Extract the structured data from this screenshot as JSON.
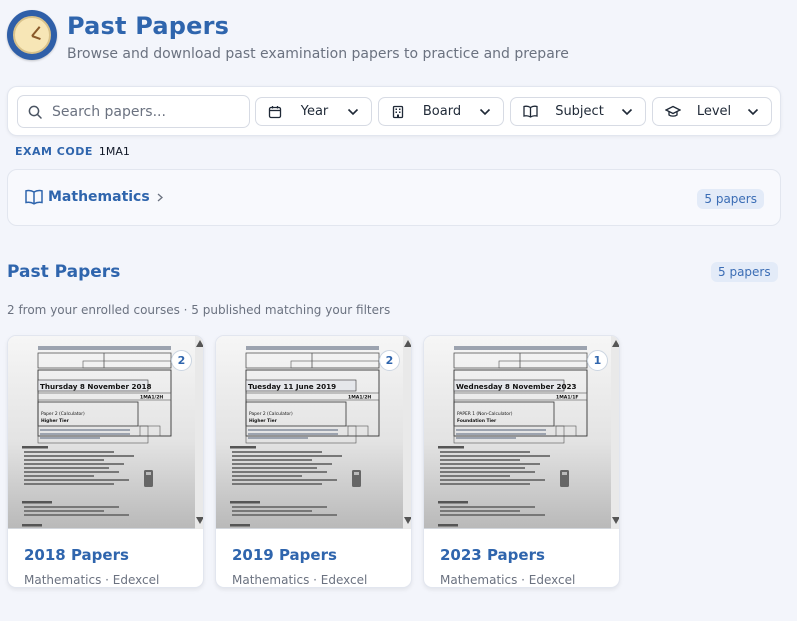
{
  "header": {
    "title": "Past Papers",
    "subtitle": "Browse and download past examination papers to practice and prepare"
  },
  "filters": {
    "search_placeholder": "Search papers...",
    "year_label": "Year",
    "board_label": "Board",
    "subject_label": "Subject",
    "level_label": "Level"
  },
  "exam_code": {
    "label": "EXAM CODE",
    "value": "1MA1"
  },
  "subject_row": {
    "name": "Mathematics",
    "count": "5 papers"
  },
  "section": {
    "title": "Past Papers",
    "count": "5 papers",
    "subtitle": "2 from your enrolled courses · 5 published matching your filters"
  },
  "cards": [
    {
      "title": "2018 Papers",
      "meta": "Mathematics · Edexcel",
      "badge": "2",
      "doc": {
        "date": "Thursday 8 November 2018",
        "paper_ref": "1MA1/2H",
        "paper": "Paper 2 (Calculator)",
        "tier": "Higher Tier"
      }
    },
    {
      "title": "2019 Papers",
      "meta": "Mathematics · Edexcel",
      "badge": "2",
      "doc": {
        "date": "Tuesday 11 June 2019",
        "paper_ref": "1MA1/2H",
        "paper": "Paper 2 (Calculator)",
        "tier": "Higher Tier"
      }
    },
    {
      "title": "2023 Papers",
      "meta": "Mathematics · Edexcel",
      "badge": "1",
      "doc": {
        "date": "Wednesday 8 November 2023",
        "paper_ref": "1MA1/1F",
        "paper": "PAPER 1 (Non-Calculator)",
        "tier": "Foundation Tier"
      }
    }
  ],
  "colors": {
    "accent": "#2f65ad",
    "background": "#f3f5fb"
  }
}
